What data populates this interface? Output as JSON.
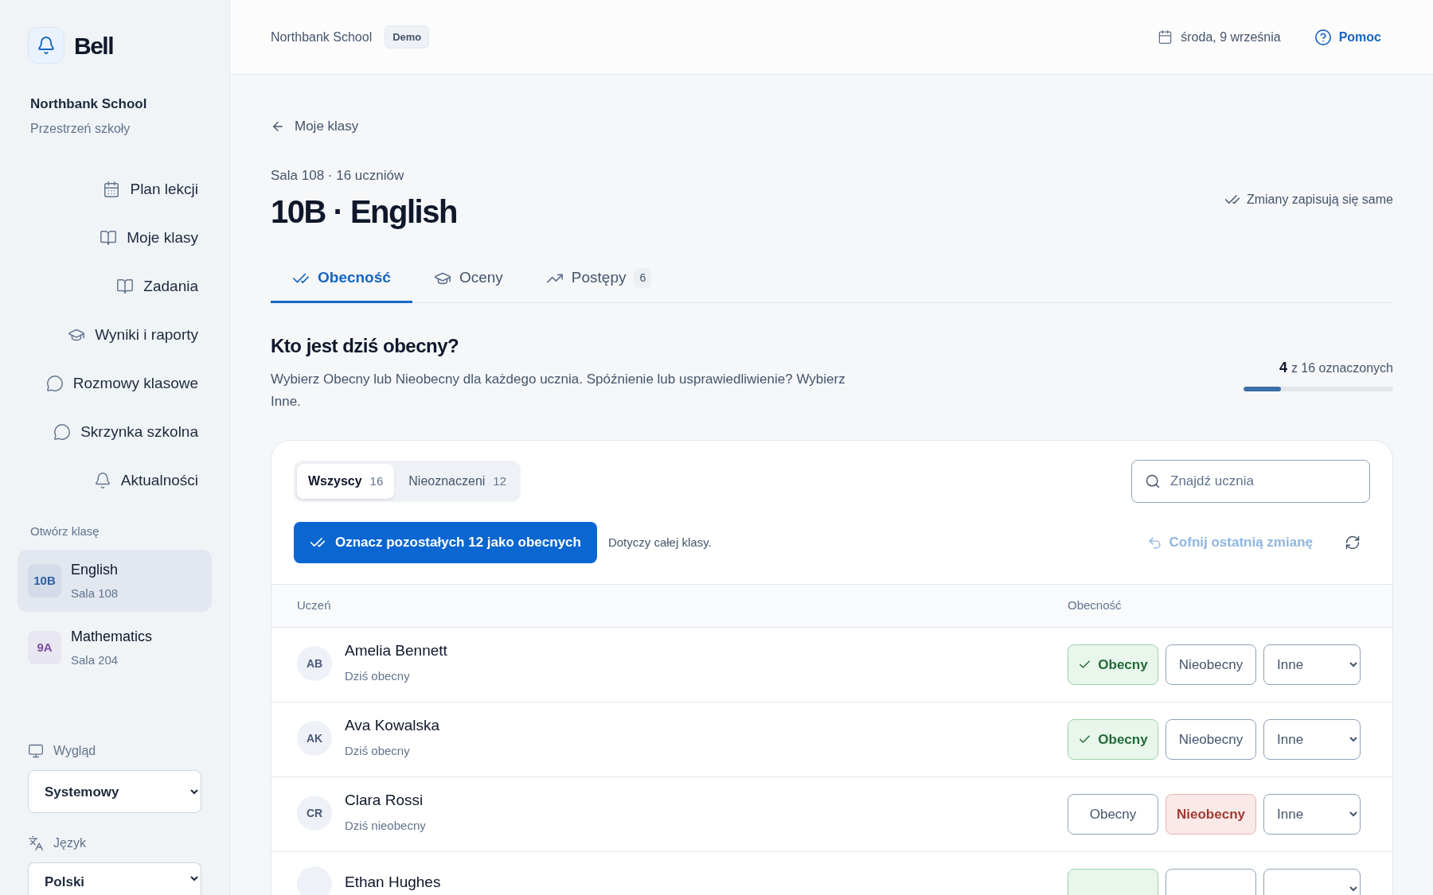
{
  "brand": {
    "name": "Bell"
  },
  "school": {
    "name": "Northbank School",
    "subtitle": "Przestrzeń szkoły"
  },
  "nav": [
    {
      "label": "Plan lekcji",
      "kind": "calendar"
    },
    {
      "label": "Moje klasy",
      "kind": "book"
    },
    {
      "label": "Zadania",
      "kind": "book"
    },
    {
      "label": "Wyniki i raporty",
      "kind": "cap"
    },
    {
      "label": "Rozmowy klasowe",
      "kind": "chat"
    },
    {
      "label": "Skrzynka szkolna",
      "kind": "chat"
    },
    {
      "label": "Aktualności",
      "kind": "bell"
    }
  ],
  "classes_heading": "Otwórz klasę",
  "classes": [
    {
      "code": "10B",
      "name": "English",
      "room": "Sala 108",
      "selected": true,
      "color": "#2f5f9e"
    },
    {
      "code": "9A",
      "name": "Mathematics",
      "room": "Sala 204",
      "selected": false,
      "color": "#7a4fa0"
    }
  ],
  "appearance": {
    "label": "Wygląd",
    "value": "Systemowy"
  },
  "language": {
    "label": "Język",
    "value": "Polski"
  },
  "topbar": {
    "school": "Northbank School",
    "badge": "Demo",
    "date": "środa, 9 września",
    "help": "Pomoc"
  },
  "back_link": "Moje klasy",
  "subtitle": "Sala 108 · 16 uczniów",
  "title": "10B · English",
  "autosave": "Zmiany zapisują się same",
  "tabs": [
    {
      "label": "Obecność",
      "kind": "checks",
      "selected": true
    },
    {
      "label": "Oceny",
      "kind": "cap",
      "selected": false
    },
    {
      "label": "Postępy",
      "kind": "trend",
      "badge": "6",
      "selected": false
    }
  ],
  "section": {
    "heading": "Kto jest dziś obecny?",
    "description": "Wybierz Obecny lub Nieobecny dla każdego ucznia. Spóźnienie lub usprawiedliwienie? Wybierz Inne.",
    "progress": {
      "count": "4",
      "text": "z 16 oznaczonych",
      "level": 0.25
    }
  },
  "filters": [
    {
      "label": "Wszyscy",
      "count": "16",
      "selected": true
    },
    {
      "label": "Nieoznaczeni",
      "count": "12",
      "selected": false
    }
  ],
  "search": {
    "placeholder": "Znajdź ucznia"
  },
  "bulk_button": "Oznacz pozostałych 12 jako obecnych",
  "bulk_note": "Dotyczy całej klasy.",
  "undo": {
    "label": "Cofnij ostatnią zmianę",
    "disabled": true
  },
  "table": {
    "columns": [
      "Uczeń",
      "Obecność"
    ],
    "rows": [
      {
        "initials": "AB",
        "name": "Amelia Bennett",
        "note": "Dziś obecny",
        "present_label": "Obecny",
        "absent_label": "Nieobecny",
        "other": "Inne",
        "present": true,
        "absent": false
      },
      {
        "initials": "AK",
        "name": "Ava Kowalska",
        "note": "Dziś obecny",
        "present_label": "Obecny",
        "absent_label": "Nieobecny",
        "other": "Inne",
        "present": true,
        "absent": false
      },
      {
        "initials": "CR",
        "name": "Clara Rossi",
        "note": "Dziś nieobecny",
        "present_label": "Obecny",
        "absent_label": "Nieobecny",
        "other": "Inne",
        "present": false,
        "absent": true
      },
      {
        "name": "Ethan Hughes",
        "present": true,
        "absent": false
      }
    ]
  }
}
